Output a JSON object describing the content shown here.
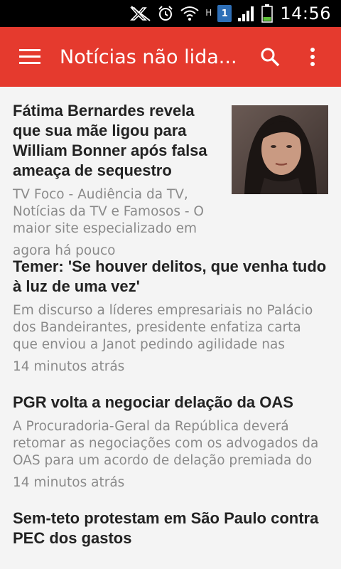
{
  "status_bar": {
    "time": "14:56",
    "network_type": "H",
    "sim_slot": "1",
    "icons": [
      "mute-icon",
      "alarm-icon",
      "wifi-icon",
      "signal-icon",
      "battery-icon"
    ]
  },
  "app_bar": {
    "title": "Notícias não lida...",
    "background": "#e53a2e"
  },
  "articles": [
    {
      "headline": "Fátima Bernardes revela que sua mãe ligou para William Bonner após falsa ameaça de sequestro",
      "summary": "TV Foco - Audiência da TV, Notícias da TV e Famosos - O maior site especializado em",
      "time": "agora há pouco",
      "has_thumbnail": true
    },
    {
      "headline": "Temer: 'Se houver delitos, que venha tudo à luz de uma vez'",
      "summary": "Em discurso a líderes empresariais no Palácio dos Bandeirantes, presidente enfatiza carta que enviou a Janot pedindo agilidade nas",
      "time": "14 minutos atrás"
    },
    {
      "headline": "PGR volta a negociar delação da OAS",
      "summary": "A Procuradoria-Geral da República deverá retomar as negociações com os advogados da OAS para um acordo de delação premiada do",
      "time": "14 minutos atrás"
    },
    {
      "headline": "Sem-teto protestam em São Paulo contra PEC dos gastos"
    }
  ]
}
